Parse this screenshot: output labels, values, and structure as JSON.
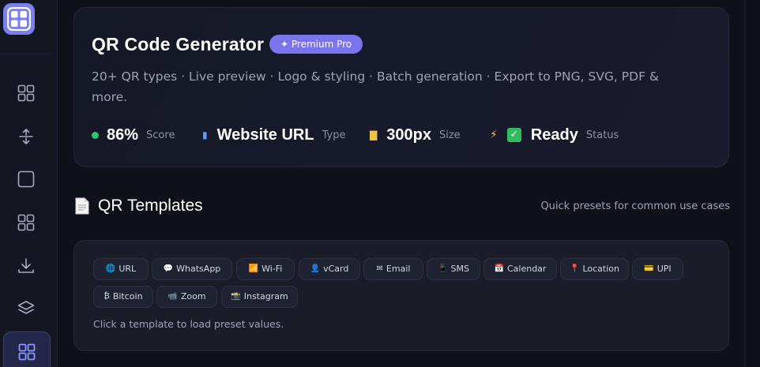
{
  "sidebar": {
    "items": [
      {
        "name": "nav-grid-icon"
      },
      {
        "name": "nav-sort-icon"
      },
      {
        "name": "nav-square-icon"
      },
      {
        "name": "nav-grid2-icon"
      },
      {
        "name": "nav-download-icon"
      },
      {
        "name": "nav-layers-icon"
      },
      {
        "name": "nav-grid-active-icon"
      }
    ]
  },
  "hero": {
    "title": "QR Code Generator",
    "badge": "✦ Premium Pro",
    "description": "20+ QR types · Live preview · Logo & styling · Batch generation · Export to PNG, SVG, PDF & more.",
    "stats": [
      {
        "value": "86%",
        "label": "Score"
      },
      {
        "value": "Website URL",
        "label": "Type"
      },
      {
        "value": "300px",
        "label": "Size"
      },
      {
        "value": "Ready",
        "label": "Status"
      }
    ],
    "status_color": "#28c76f"
  },
  "templates": {
    "title": "QR Templates",
    "subtitle": "Quick presets for common use cases",
    "chips": [
      {
        "icon": "🌐",
        "label": "URL"
      },
      {
        "icon": "💬",
        "label": "WhatsApp"
      },
      {
        "icon": "📶",
        "label": "Wi-Fi"
      },
      {
        "icon": "👤",
        "label": "vCard"
      },
      {
        "icon": "✉",
        "label": "Email"
      },
      {
        "icon": "📱",
        "label": "SMS"
      },
      {
        "icon": "📅",
        "label": "Calendar"
      },
      {
        "icon": "📍",
        "label": "Location"
      },
      {
        "icon": "💳",
        "label": "UPI"
      },
      {
        "icon": "₿",
        "label": "Bitcoin"
      },
      {
        "icon": "📹",
        "label": "Zoom"
      },
      {
        "icon": "📸",
        "label": "Instagram"
      }
    ],
    "hint": "Click a template to load preset values."
  },
  "colors": {
    "accent": "#7c74ea",
    "background": "#0f1119"
  }
}
